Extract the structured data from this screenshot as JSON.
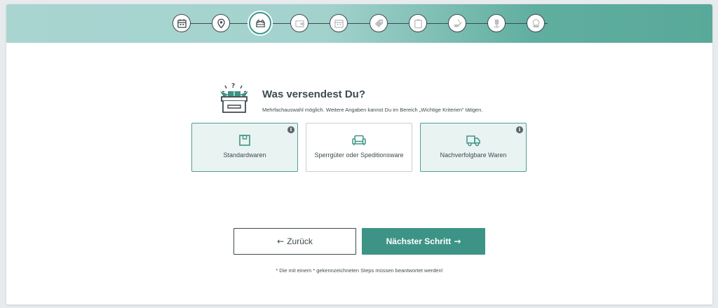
{
  "steps": [
    {
      "icon": "calendar-icon",
      "state": "done"
    },
    {
      "icon": "location-pin-icon",
      "state": "done"
    },
    {
      "icon": "open-box-icon",
      "state": "active"
    },
    {
      "icon": "wallet-icon",
      "state": "future"
    },
    {
      "icon": "calendar-icon",
      "state": "future"
    },
    {
      "icon": "price-tag-icon",
      "state": "future"
    },
    {
      "icon": "clipboard-icon",
      "state": "future"
    },
    {
      "icon": "hand-icon",
      "state": "future"
    },
    {
      "icon": "trophy-icon",
      "state": "future"
    },
    {
      "icon": "seal-icon",
      "state": "future"
    }
  ],
  "question": {
    "icon": "open-box-question-icon",
    "title": "Was versendest Du?",
    "subtitle": "Mehrfachauswahl möglich. Weitere Angaben kannst Du im Bereich „Wichtige Kriterien\" tätigen."
  },
  "options": [
    {
      "label": "Standardwaren",
      "icon": "package-icon",
      "selected": true,
      "has_info": true
    },
    {
      "label": "Sperrgüter oder Speditionsware",
      "icon": "sofa-icon",
      "selected": false,
      "has_info": false
    },
    {
      "label": "Nachverfolgbare Waren",
      "icon": "truck-icon",
      "selected": true,
      "has_info": true
    }
  ],
  "info_glyph": "i",
  "buttons": {
    "back_label": "Zurück",
    "back_arrow": "←",
    "next_label": "Nächster Schritt",
    "next_arrow": "→"
  },
  "footnote": "* Die mit einem * gekennzeichneten Steps müssen beantwortet werden!",
  "colors": {
    "accent": "#3d9486",
    "selected_bg": "#e9f3f2",
    "text": "#3f4a4f"
  }
}
